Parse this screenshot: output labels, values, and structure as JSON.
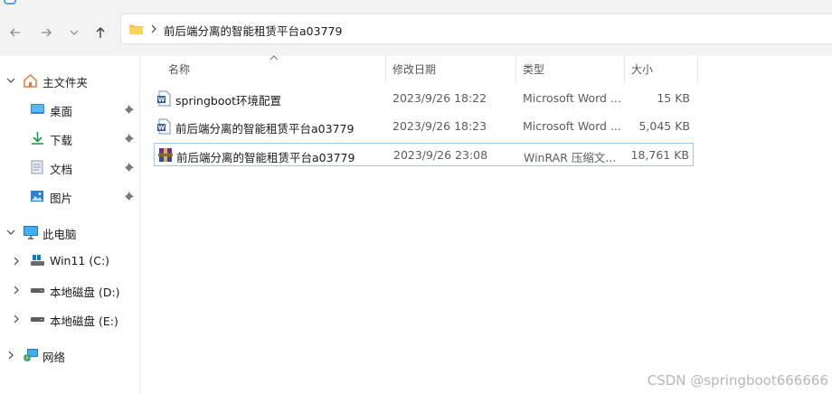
{
  "address_bar": {
    "path_segments": [
      "前后端分离的智能租赁平台a03779"
    ]
  },
  "navigation_pane": {
    "quick_access": {
      "label": "主文件夹",
      "items": [
        {
          "label": "桌面",
          "icon": "desktop-icon",
          "pinned": true
        },
        {
          "label": "下载",
          "icon": "download-icon",
          "pinned": true
        },
        {
          "label": "文档",
          "icon": "documents-icon",
          "pinned": true
        },
        {
          "label": "图片",
          "icon": "pictures-icon",
          "pinned": true
        }
      ]
    },
    "this_pc": {
      "label": "此电脑",
      "drives": [
        {
          "label": "Win11 (C:)",
          "icon": "system-drive-icon"
        },
        {
          "label": "本地磁盘 (D:)",
          "icon": "drive-icon"
        },
        {
          "label": "本地磁盘 (E:)",
          "icon": "drive-icon"
        }
      ]
    },
    "network": {
      "label": "网络"
    }
  },
  "file_list": {
    "columns": {
      "name": "名称",
      "date": "修改日期",
      "type": "类型",
      "size": "大小"
    },
    "sort_column": "name",
    "rows": [
      {
        "name": "springboot环境配置",
        "date": "2023/9/26 18:22",
        "type": "Microsoft Word ...",
        "size": "15 KB",
        "icon": "word-doc-icon",
        "selected": false
      },
      {
        "name": "前后端分离的智能租赁平台a03779",
        "date": "2023/9/26 18:23",
        "type": "Microsoft Word ...",
        "size": "5,045 KB",
        "icon": "word-doc-icon",
        "selected": false
      },
      {
        "name": "前后端分离的智能租赁平台a03779",
        "date": "2023/9/26 23:08",
        "type": "WinRAR 压缩文...",
        "size": "18,761 KB",
        "icon": "winrar-archive-icon",
        "selected": true
      }
    ]
  },
  "watermark": "CSDN @springboot666666",
  "colors": {
    "accent": "#0067c0",
    "selection_border": "#99c9ef",
    "folder": "#f4c542"
  }
}
